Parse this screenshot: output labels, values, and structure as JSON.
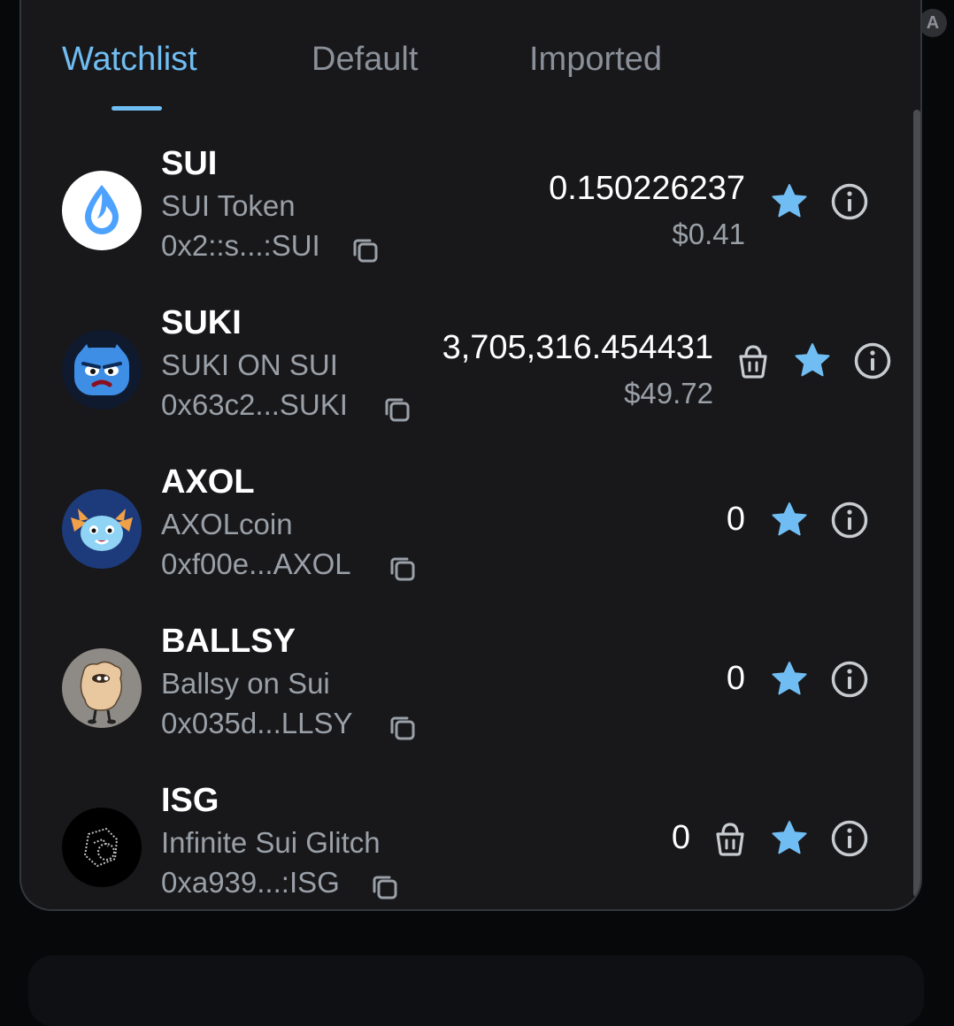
{
  "tabs": [
    {
      "label": "Watchlist",
      "active": true
    },
    {
      "label": "Default",
      "active": false
    },
    {
      "label": "Imported",
      "active": false
    }
  ],
  "corner_avatar_letter": "A",
  "accent_color": "#70bdf3",
  "tokens": [
    {
      "symbol": "SUI",
      "name": "SUI Token",
      "address": "0x2::s...:SUI",
      "amount": "0.150226237",
      "fiat": "$0.41",
      "logo": "sui-drop-logo",
      "has_delete": false
    },
    {
      "symbol": "SUKI",
      "name": "SUKI ON SUI",
      "address": "0x63c2...SUKI",
      "amount": "3,705,316.454431",
      "fiat": "$49.72",
      "logo": "angry-blue-creature-logo",
      "has_delete": true
    },
    {
      "symbol": "AXOL",
      "name": "AXOLcoin",
      "address": "0xf00e...AXOL",
      "amount": "0",
      "fiat": "",
      "logo": "axolotl-logo",
      "has_delete": false
    },
    {
      "symbol": "BALLSY",
      "name": "Ballsy on Sui",
      "address": "0x035d...LLSY",
      "amount": "0",
      "fiat": "",
      "logo": "ballsy-character-logo",
      "has_delete": false
    },
    {
      "symbol": "ISG",
      "name": "Infinite Sui Glitch",
      "address": "0xa939...:ISG",
      "amount": "0",
      "fiat": "",
      "logo": "glitch-logo",
      "has_delete": true
    }
  ]
}
